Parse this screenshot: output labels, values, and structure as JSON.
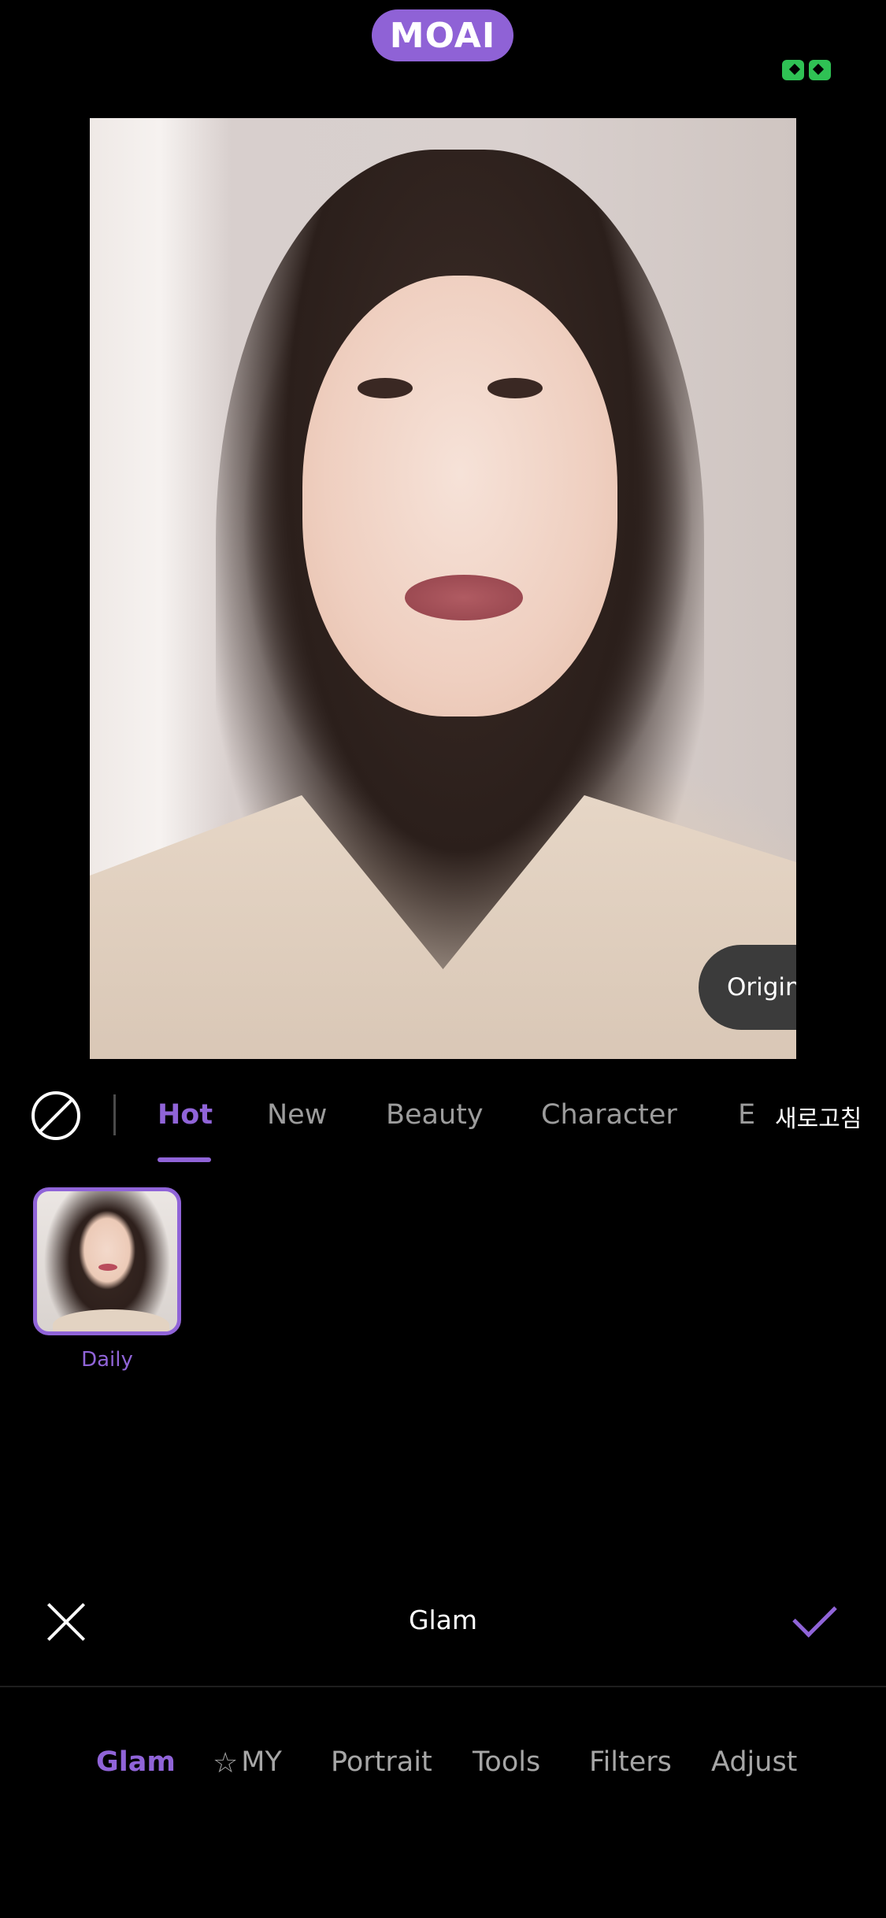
{
  "header": {
    "logo_text": "MOAI"
  },
  "photo": {
    "original_label": "Original"
  },
  "categories": {
    "tabs": [
      "Hot",
      "New",
      "Beauty",
      "Character",
      "E"
    ],
    "active_index": 0,
    "refresh_label": "새로고침"
  },
  "presets": [
    {
      "label": "Daily",
      "selected": true
    }
  ],
  "action_bar": {
    "title": "Glam"
  },
  "bottom_nav": {
    "items": [
      "Glam",
      "MY",
      "Portrait",
      "Tools",
      "Filters",
      "Adjust"
    ],
    "my_icon": "star-outline-icon",
    "active_index": 0
  },
  "colors": {
    "accent": "#9064d8",
    "badge": "#2fc154"
  }
}
